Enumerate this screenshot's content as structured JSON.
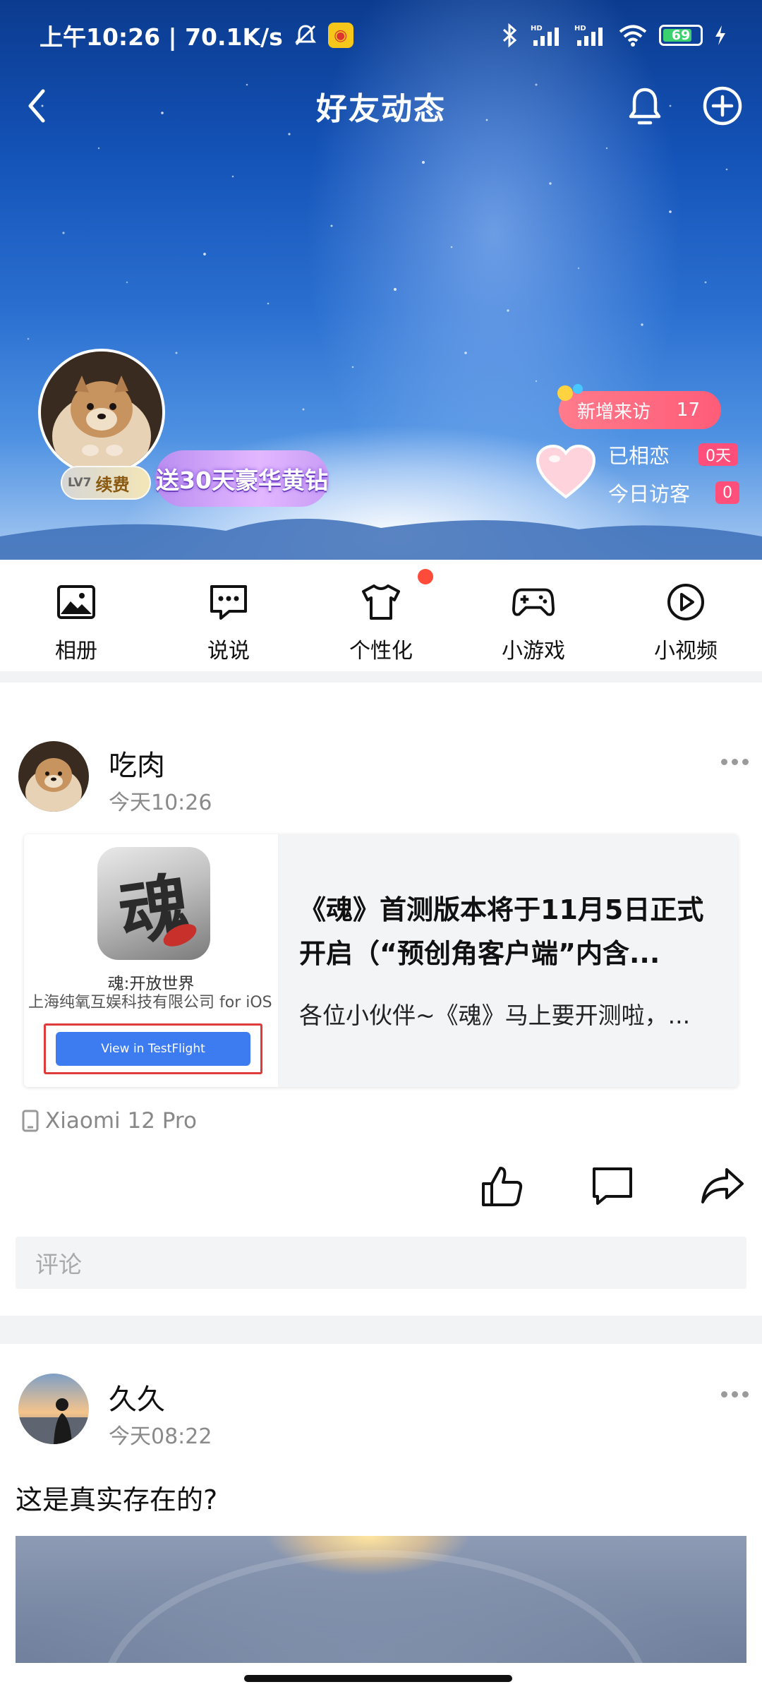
{
  "status_bar": {
    "time_speed": "上午10:26 | 70.1K/s",
    "battery": "69",
    "network_1": "HD",
    "network_2": "HD"
  },
  "nav": {
    "title": "好友动态"
  },
  "profile": {
    "level": "LV7",
    "renew": "续费",
    "promo": "送30天豪华黄钻",
    "new_visitors_label": "新增来访",
    "new_visitors_count": "17",
    "together_label": "已相恋",
    "together_days": "0天",
    "today_visitors_label": "今日访客",
    "today_visitors_count": "0"
  },
  "quick_nav": [
    {
      "label": "相册",
      "icon": "album-icon"
    },
    {
      "label": "说说",
      "icon": "chat-icon"
    },
    {
      "label": "个性化",
      "icon": "tshirt-icon"
    },
    {
      "label": "小游戏",
      "icon": "gamepad-icon"
    },
    {
      "label": "小视频",
      "icon": "play-icon"
    }
  ],
  "post1": {
    "name": "吃肉",
    "time": "今天10:26",
    "card": {
      "app_name": "魂:开放世界",
      "company": "上海纯氧互娱科技有限公司 for iOS",
      "button": "View in TestFlight",
      "icon_glyph": "魂",
      "title": "《魂》首测版本将于11月5日正式开启（“预创角客户端”内含...",
      "desc": "各位小伙伴~《魂》马上要开测啦，..."
    },
    "device": "Xiaomi 12 Pro",
    "comment_placeholder": "评论"
  },
  "post2": {
    "name": "久久",
    "time": "今天08:22",
    "text": "这是真实存在的?"
  },
  "colors": {
    "accent_red": "#ff4b3a",
    "visitor_pink": "#ff5c78",
    "testflight_blue": "#3d7bf0"
  }
}
